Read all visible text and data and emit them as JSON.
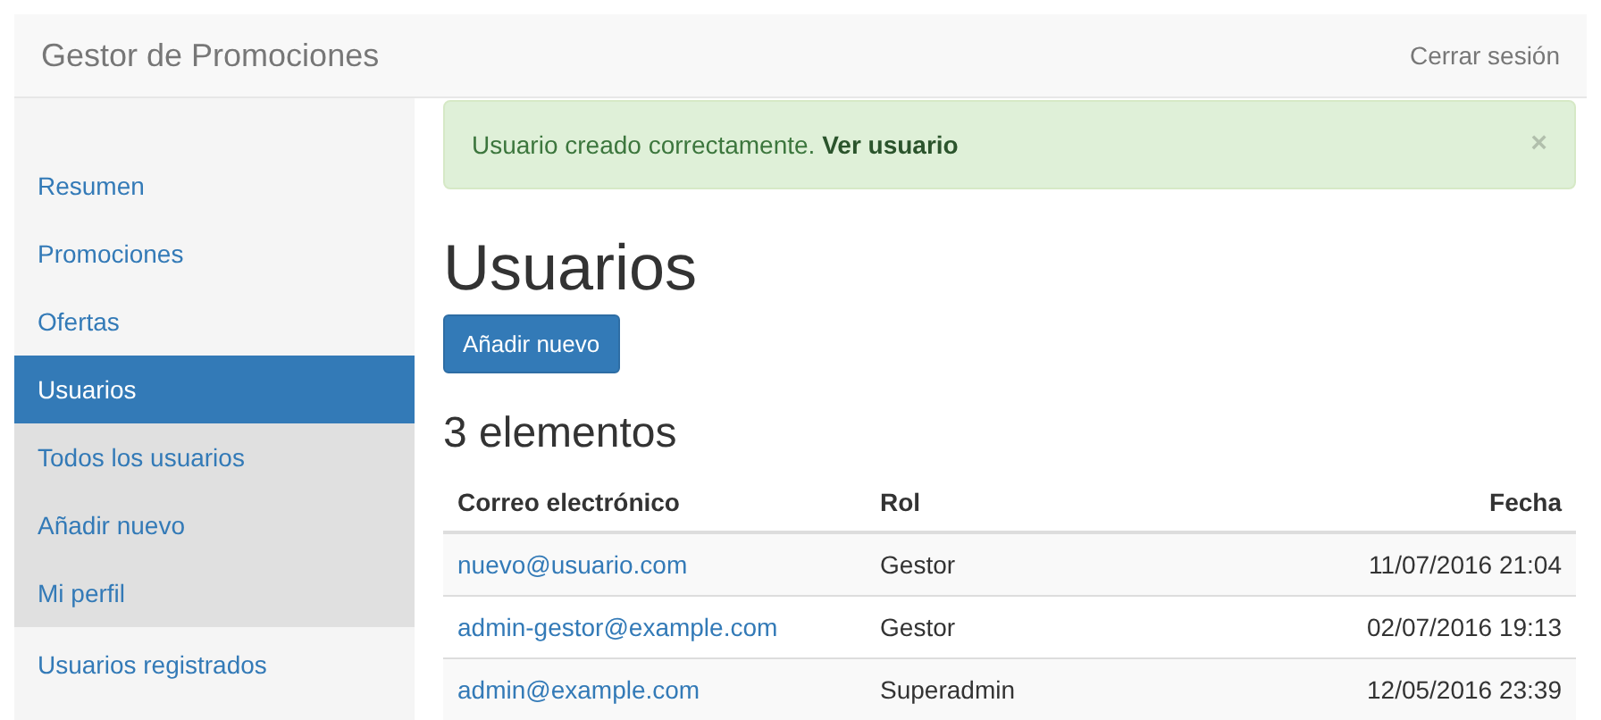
{
  "navbar": {
    "brand": "Gestor de Promociones",
    "logout": "Cerrar sesión"
  },
  "sidebar": {
    "items": [
      {
        "label": "Resumen",
        "selected": false
      },
      {
        "label": "Promociones",
        "selected": false
      },
      {
        "label": "Ofertas",
        "selected": false
      },
      {
        "label": "Usuarios",
        "selected": true,
        "children": [
          {
            "label": "Todos los usuarios",
            "selected": false
          },
          {
            "label": "Añadir nuevo",
            "selected": false
          },
          {
            "label": "Mi perfil",
            "selected": false
          }
        ]
      },
      {
        "label": "Usuarios registrados",
        "selected": false
      }
    ]
  },
  "alert": {
    "message": "Usuario creado correctamente.",
    "link": "Ver usuario",
    "close": "×"
  },
  "page_title": "Usuarios",
  "add_button": "Añadir nuevo",
  "count": "3 elementos",
  "table": {
    "columns": [
      "Correo electrónico",
      "Rol",
      "Fecha"
    ],
    "rows": [
      [
        "nuevo@usuario.com",
        "Gestor",
        "11/07/2016 21:04"
      ],
      [
        "admin-gestor@example.com",
        "Gestor",
        "02/07/2016 19:13"
      ],
      [
        "admin@example.com",
        "Superadmin",
        "12/05/2016 23:39"
      ]
    ]
  }
}
